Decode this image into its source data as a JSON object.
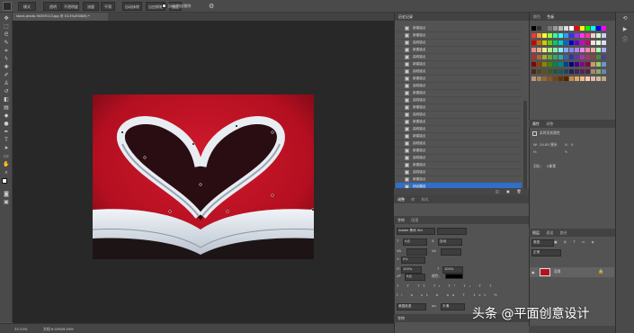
{
  "option_bar": {
    "items": [
      "模式",
      "透明",
      "不透明度",
      "流量",
      "平滑",
      "自动抹除",
      "自由钢笔",
      "锁定"
    ],
    "auto_add_delete": "自动添加/删除"
  },
  "document_tab": {
    "title": "stock-photo-94359113.jpg @ 33.3%(RGB/8) *"
  },
  "status": {
    "zoom": "33.33%",
    "doc_info": "文档:9.03M/9.03M"
  },
  "history_panel": {
    "title": "历史记录",
    "items": [
      "新建锚点",
      "新建锚点",
      "曲线锚点",
      "新建锚点",
      "曲线锚点",
      "新建锚点",
      "曲线锚点",
      "新建锚点",
      "曲线锚点",
      "新建锚点",
      "曲线锚点",
      "新建锚点",
      "曲线锚点",
      "新建锚点",
      "曲线锚点",
      "新建锚点",
      "曲线锚点",
      "新建锚点",
      "曲线锚点",
      "新建锚点",
      "曲线锚点",
      "新建锚点",
      "闭合路径"
    ],
    "active_index": 22
  },
  "adjust_panel": {
    "tabs": [
      "调整",
      "库",
      "样式"
    ]
  },
  "type_panel": {
    "tabs": [
      "字符",
      "段落"
    ],
    "font": "Adobe 黑体 Std",
    "size": "0点",
    "leading": "自动",
    "tracking": "0%",
    "scale_v": "100%",
    "scale_h": "100%",
    "baseline": "0点",
    "lang": "美国英语",
    "aa": "平滑"
  },
  "swatches_panel": {
    "tabs": [
      "颜色",
      "色板"
    ]
  },
  "properties_panel": {
    "tabs": [
      "属性",
      "调整"
    ],
    "subtitle": "实时形状属性",
    "w_label": "W:",
    "w_value": "24.85 厘米",
    "x_label": "X:",
    "x_value": "0",
    "h_label": "H:",
    "y_label": "Y:",
    "feather": "羽化:",
    "feather_value": "0像素"
  },
  "layers_panel": {
    "tabs": [
      "图层",
      "通道",
      "路径"
    ],
    "kind": "类型",
    "blend": "正常",
    "layer_name": "背景"
  },
  "watermark": "头条 @平面创意设计",
  "colors": {
    "accent": "#2f6fc9",
    "image_red": "#b5101f"
  }
}
